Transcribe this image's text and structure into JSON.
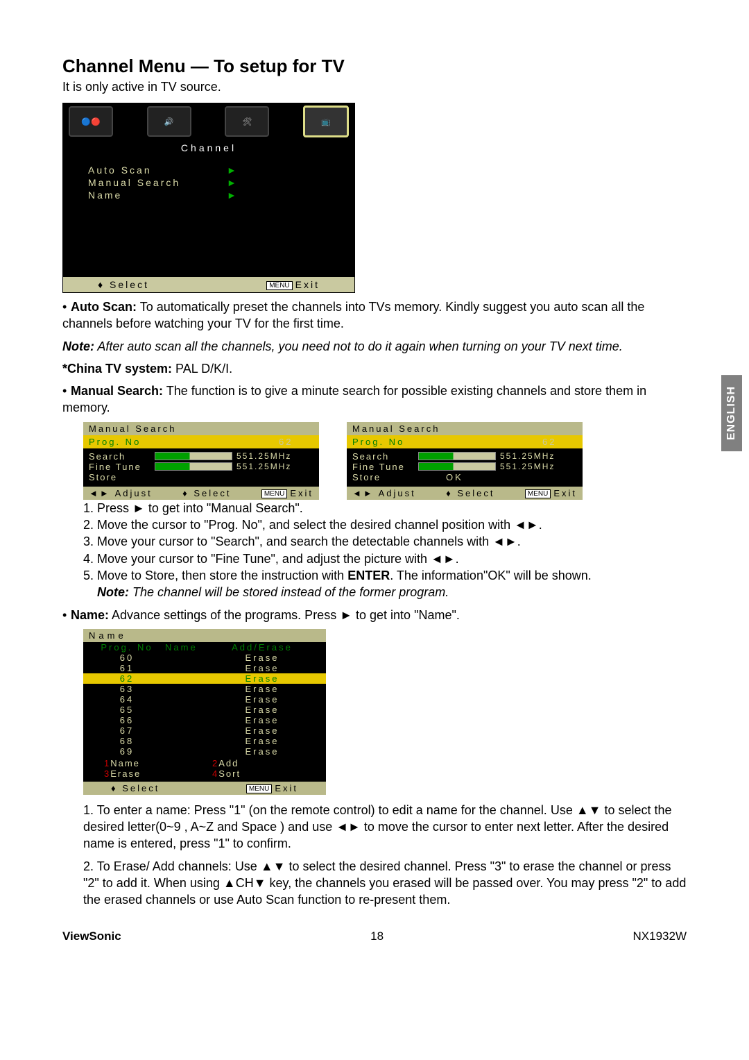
{
  "title": "Channel Menu — To setup for TV",
  "subtitle": "It is only active in TV source.",
  "osd1": {
    "title": "Channel",
    "items": [
      "Auto Scan",
      "Manual Search",
      "Name"
    ],
    "foot_select": "Select",
    "foot_menu": "MENU",
    "foot_exit": "Exit"
  },
  "autoscan": {
    "label": "Auto Scan:",
    "text": " To automatically preset the channels into TVs memory. Kindly suggest you auto scan all the channels before watching your TV for the first time.",
    "note_label": "Note:",
    "note_text": " After auto scan all the channels, you need not to do it again when turning on your TV next time.",
    "china_label": "*China TV system:",
    "china_value": " PAL D/K/I."
  },
  "manual": {
    "label": "Manual Search:",
    "text": " The function is to give a minute search for possible existing channels and store them in memory.",
    "panel": {
      "title": "Manual Search",
      "prog_label": "Prog. No",
      "prog_value": "62",
      "search": "Search",
      "fine": "Fine Tune",
      "store": "Store",
      "freq": "551.25MHz",
      "ok": "OK",
      "adjust": "Adjust",
      "select": "Select",
      "menu": "MENU",
      "exit": "Exit"
    },
    "steps": [
      "Press ► to get into \"Manual Search\".",
      "Move the cursor to \"Prog. No\", and select the desired channel position with ◄►.",
      "Move your cursor to \"Search\", and search the detectable channels with ◄►.",
      "Move your cursor to \"Fine Tune\", and adjust the picture with ◄►.",
      "Move to Store, then store the instruction with ENTER. The information\"OK\" will be shown."
    ],
    "steps_note_label": "Note:",
    "steps_note": " The channel will be stored instead of the former program."
  },
  "name": {
    "label": "Name:",
    "text": " Advance settings of the programs. Press ► to get into \"Name\".",
    "panel_title": "Name",
    "cols": [
      "Prog. No",
      "Name",
      "Add/Erase"
    ],
    "rows": [
      {
        "no": "60",
        "name": "",
        "ae": "Erase",
        "sel": false
      },
      {
        "no": "61",
        "name": "",
        "ae": "Erase",
        "sel": false
      },
      {
        "no": "62",
        "name": "",
        "ae": "Erase",
        "sel": true
      },
      {
        "no": "63",
        "name": "",
        "ae": "Erase",
        "sel": false
      },
      {
        "no": "64",
        "name": "",
        "ae": "Erase",
        "sel": false
      },
      {
        "no": "65",
        "name": "",
        "ae": "Erase",
        "sel": false
      },
      {
        "no": "66",
        "name": "",
        "ae": "Erase",
        "sel": false
      },
      {
        "no": "67",
        "name": "",
        "ae": "Erase",
        "sel": false
      },
      {
        "no": "68",
        "name": "",
        "ae": "Erase",
        "sel": false
      },
      {
        "no": "69",
        "name": "",
        "ae": "Erase",
        "sel": false
      }
    ],
    "legend": [
      {
        "n": "1",
        "t": "Name"
      },
      {
        "n": "2",
        "t": "Add"
      },
      {
        "n": "3",
        "t": "Erase"
      },
      {
        "n": "4",
        "t": "Sort"
      }
    ],
    "foot_select": "Select",
    "foot_menu": "MENU",
    "foot_exit": "Exit",
    "para1": "1. To enter a name: Press \"1\" (on the remote control) to edit a name for the channel. Use ▲▼ to select the desired letter(0~9 , A~Z and Space ) and use ◄► to move the cursor to enter next letter. After the desired name is entered, press \"1\"  to confirm.",
    "para2": "2.  To Erase/ Add channels: Use ▲▼ to select the desired channel. Press \"3\" to erase the channel or press \"2\" to add it. When using ▲CH▼ key, the channels you erased will be passed over. You may press \"2\"  to add the erased channels or use Auto Scan function to re-present them."
  },
  "footer": {
    "brand": "ViewSonic",
    "page": "18",
    "model": "NX1932W"
  },
  "sidetab": "ENGLISH"
}
